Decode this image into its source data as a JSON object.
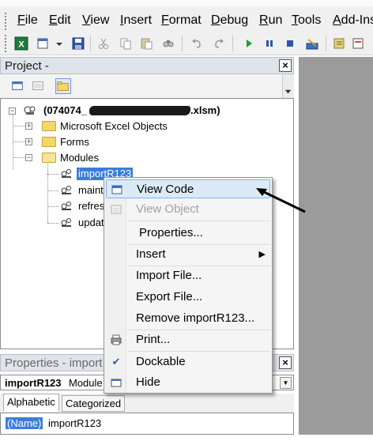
{
  "menubar": {
    "items": [
      "File",
      "Edit",
      "View",
      "Insert",
      "Format",
      "Debug",
      "Run",
      "Tools",
      "Add-Ins"
    ]
  },
  "toolbar": {
    "icons": [
      "excel-icon",
      "insert-module-icon",
      "save-icon",
      "cut-icon",
      "copy-icon",
      "paste-icon",
      "find-icon",
      "undo-icon",
      "redo-icon",
      "run-icon",
      "break-icon",
      "reset-icon",
      "design-mode-icon",
      "project-explorer-icon"
    ]
  },
  "project": {
    "title": "Project -",
    "close": "×",
    "root_label": "(074074_",
    "root_ext": ".xlsm)",
    "items": [
      {
        "label": "Microsoft Excel Objects",
        "expander": "+"
      },
      {
        "label": "Forms",
        "expander": "+"
      },
      {
        "label": "Modules",
        "expander": "−"
      }
    ],
    "modules": [
      "importR123",
      "maint",
      "refres",
      "updat"
    ]
  },
  "context_menu": {
    "items": [
      {
        "label": "View Code",
        "highlight": true,
        "disabled": false
      },
      {
        "label": "View Object",
        "highlight": false,
        "disabled": true
      },
      {
        "label": "Properties...",
        "highlight": false,
        "disabled": false
      },
      {
        "label": "Insert",
        "highlight": false,
        "disabled": false,
        "submenu": "▶"
      },
      {
        "label": "Import File...",
        "highlight": false,
        "disabled": false
      },
      {
        "label": "Export File...",
        "highlight": false,
        "disabled": false
      },
      {
        "label": "Remove importR123...",
        "highlight": false,
        "disabled": false
      },
      {
        "label": "Print...",
        "highlight": false,
        "disabled": false
      },
      {
        "label": "Dockable",
        "highlight": false,
        "disabled": false,
        "checked": "✔"
      },
      {
        "label": "Hide",
        "highlight": false,
        "disabled": false
      }
    ]
  },
  "properties": {
    "title": "Properties - import",
    "close": "×",
    "object_name": "importR123",
    "object_type": "Module",
    "dropdown_arrow": "▼",
    "tabs": [
      "Alphabetic",
      "Categorized"
    ],
    "row_key": "(Name)",
    "row_value": "importR123"
  },
  "colors": {
    "selection": "#3b7dd8",
    "highlight": "#dceaf8",
    "code_area": "#9b9b9b"
  }
}
